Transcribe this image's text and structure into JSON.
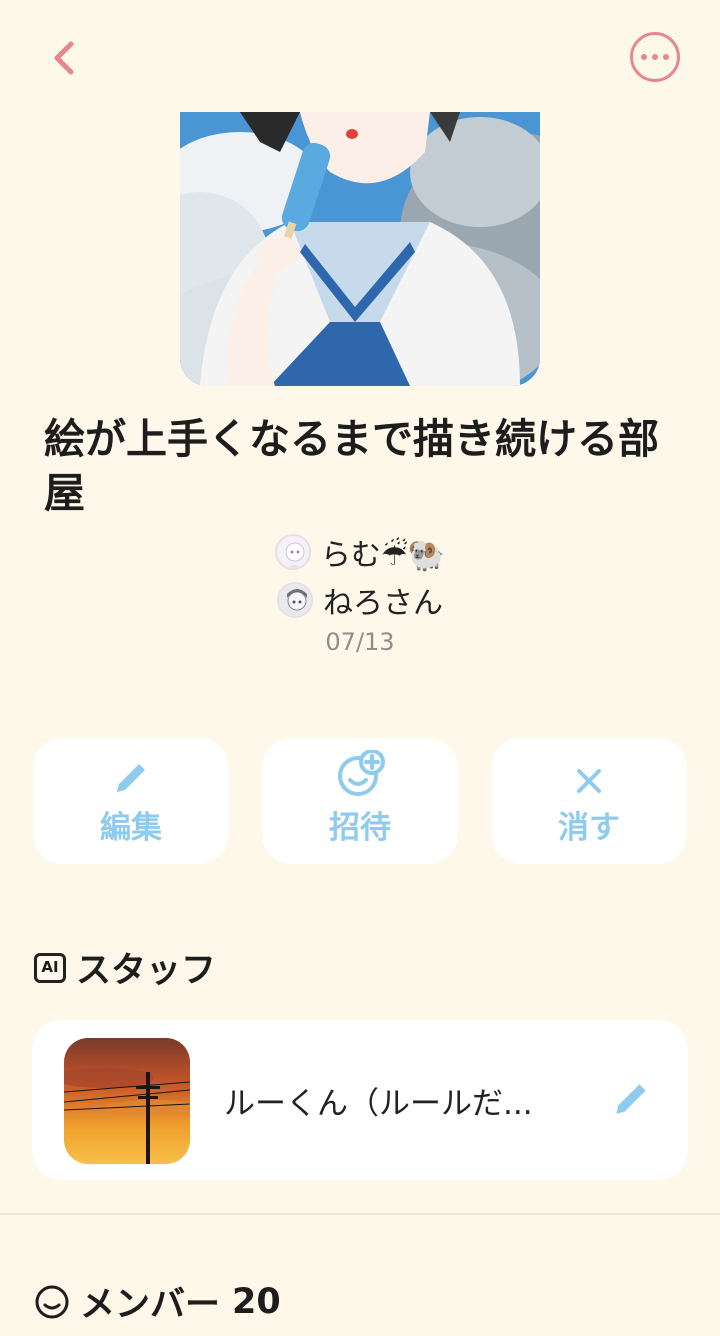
{
  "header": {
    "back_icon": "chevron-left-icon",
    "more_icon": "more-horizontal-icon",
    "accent_color": "#e7868e"
  },
  "room": {
    "title": "絵が上手くなるまで描き続ける部屋",
    "owners": [
      {
        "name": "らむ☔🐏"
      },
      {
        "name": "ねろさん"
      }
    ],
    "date": "07/13"
  },
  "actions": [
    {
      "label": "編集",
      "icon": "pencil-icon"
    },
    {
      "label": "招待",
      "icon": "add-friend-icon"
    },
    {
      "label": "消す",
      "icon": "close-icon"
    }
  ],
  "action_color": "#8fcbee",
  "staff_section": {
    "badge": "AI",
    "title": "スタッフ",
    "item": {
      "name": "ルーくん（ルールだ...",
      "edit_icon": "pencil-icon"
    }
  },
  "members_section": {
    "title": "メンバー",
    "count": "20",
    "icon": "smile-icon"
  }
}
